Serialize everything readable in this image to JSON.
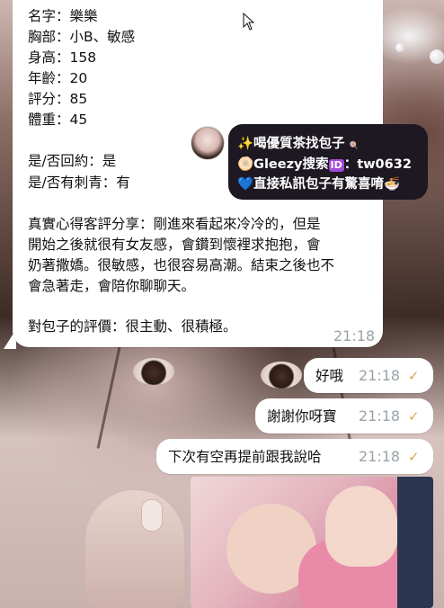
{
  "incoming": {
    "lines": [
      "名字：樂樂",
      "胸部：小B、敏感",
      "身高：158",
      "年齡：20",
      "評分：85",
      "體重：45",
      "",
      "是/否回約：是",
      "是/否有刺青：有",
      "",
      "真實心得客評分享：剛進來看起來冷冷的，但是",
      "開始之後就很有女友感，會鑽到懷裡求抱抱，會",
      "奶著撒嬌。很敏感，也很容易高潮。結束之後也不",
      "會急著走，會陪你聊聊天。",
      "",
      "對包子的評價：很主動、很積極。"
    ],
    "time": "21:18"
  },
  "ad": {
    "line1": "✨喝優質茶找包子",
    "tag": "🍭",
    "line2_prefix": "🫓Gleezy搜索",
    "id_badge": "ID",
    "line2_suffix": "：tw0632",
    "line3": "💙直接私訊包子有驚喜唷🍜"
  },
  "outgoing": [
    {
      "text": "好哦",
      "time": "21:18"
    },
    {
      "text": "謝謝你呀寶",
      "time": "21:18"
    },
    {
      "text": "下次有空再提前跟我說哈",
      "time": "21:18"
    }
  ],
  "colors": {
    "bubble": "#ffffff",
    "timestamp": "#9aa3a8",
    "read_check": "#d4a94a",
    "ad_card": "#1d1821"
  }
}
